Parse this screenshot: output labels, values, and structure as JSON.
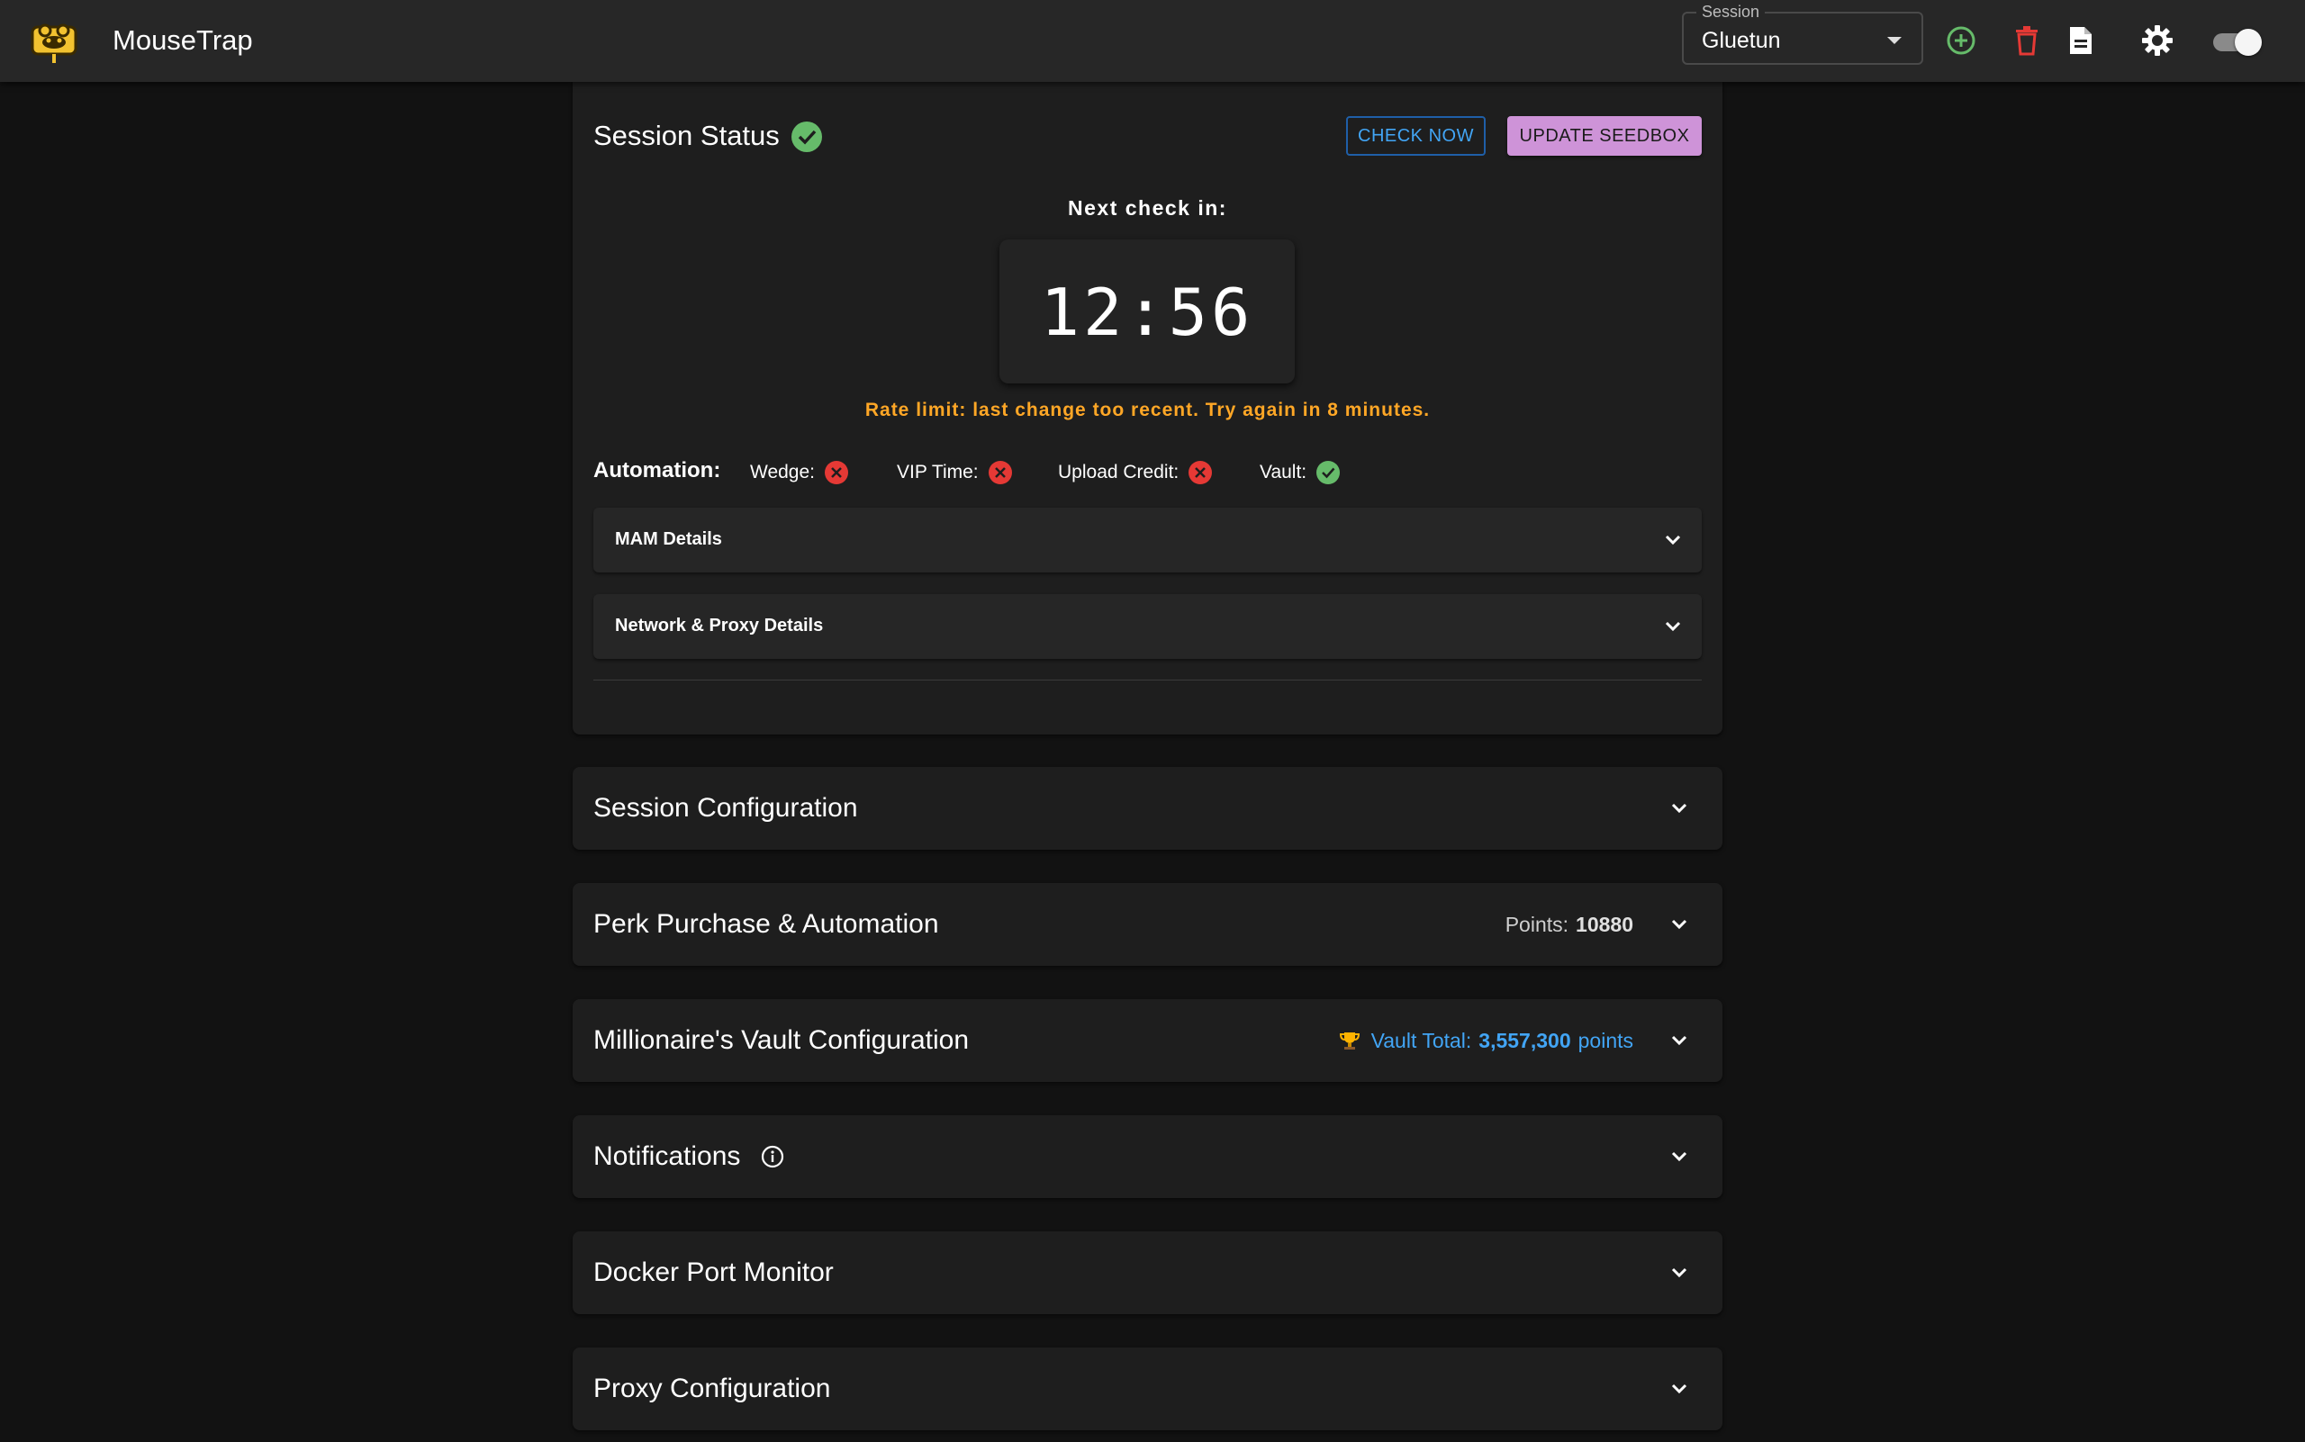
{
  "app": {
    "title": "MouseTrap"
  },
  "session": {
    "legend": "Session",
    "value": "Gluetun"
  },
  "toolbar_icons": [
    "add-circle-icon",
    "trash-icon",
    "document-icon",
    "gear-icon",
    "theme-toggle"
  ],
  "colors": {
    "accent_blue": "#42a5f5",
    "accent_purple": "#ce93d8",
    "success": "#66bb6a",
    "error": "#e53935",
    "warning": "#ffa726"
  },
  "status": {
    "title": "Session Status",
    "ok": true,
    "check_now": "CHECK NOW",
    "update_seedbox": "UPDATE SEEDBOX",
    "next_check_label": "Next check in:",
    "timer": "12:56",
    "rate_limit_msg": "Rate limit: last change too recent. Try again in 8 minutes.",
    "automation_label": "Automation:",
    "automation": [
      {
        "label": "Wedge:",
        "enabled": false
      },
      {
        "label": "VIP Time:",
        "enabled": false
      },
      {
        "label": "Upload Credit:",
        "enabled": false
      },
      {
        "label": "Vault:",
        "enabled": true
      }
    ],
    "details": [
      {
        "label": "MAM Details"
      },
      {
        "label": "Network & Proxy Details"
      }
    ]
  },
  "sections": {
    "session_config": {
      "title": "Session Configuration"
    },
    "perk": {
      "title": "Perk Purchase & Automation",
      "points_label": "Points:",
      "points_value": "10880"
    },
    "vault": {
      "title": "Millionaire's Vault Configuration",
      "total_label": "Vault Total:",
      "total_value": "3,557,300",
      "total_unit": "points"
    },
    "notifications": {
      "title": "Notifications"
    },
    "docker": {
      "title": "Docker Port Monitor"
    },
    "proxy": {
      "title": "Proxy Configuration"
    }
  }
}
